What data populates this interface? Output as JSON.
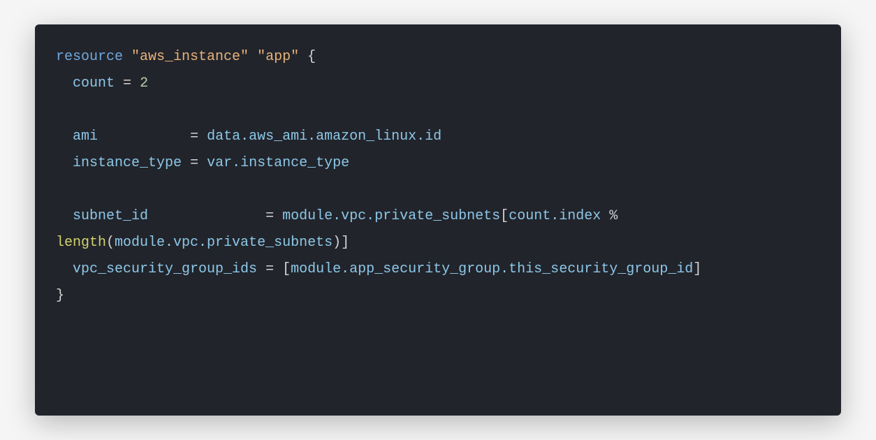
{
  "code": {
    "l1": {
      "kw": "resource",
      "str1": "\"aws_instance\"",
      "str2": "\"app\"",
      "brace": "{"
    },
    "l2": {
      "attr": "count",
      "op": "=",
      "val": "2"
    },
    "l3": {
      "attr": "ami",
      "op": "=",
      "ref": "data.aws_ami.amazon_linux.id"
    },
    "l4": {
      "attr": "instance_type",
      "op": "=",
      "ref": "var.instance_type"
    },
    "l5": {
      "attr": "subnet_id",
      "op": "=",
      "ref1": "module.vpc.private_subnets",
      "br1": "[",
      "ref2": "count.index",
      "pct": "%",
      "fn": "length",
      "paren1": "(",
      "ref3": "module.vpc.private_subnets",
      "paren2": ")",
      "br2": "]"
    },
    "l6": {
      "attr": "vpc_security_group_ids",
      "op": "=",
      "br1": "[",
      "ref": "module.app_security_group.this_security_group_id",
      "br2": "]"
    },
    "l7": {
      "brace": "}"
    }
  }
}
